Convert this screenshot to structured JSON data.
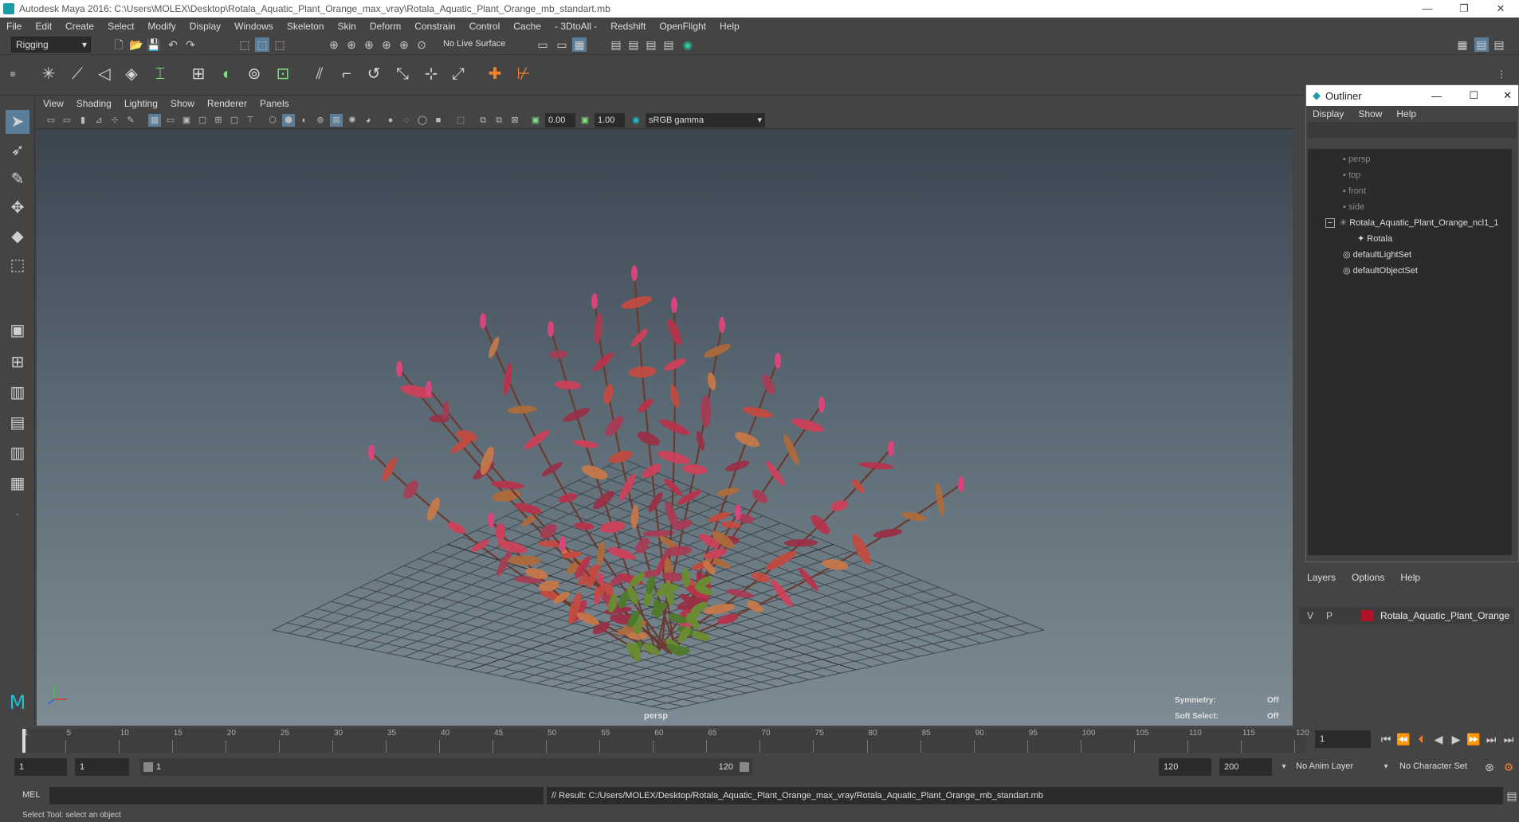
{
  "window": {
    "title": "Autodesk Maya 2016: C:\\Users\\MOLEX\\Desktop\\Rotala_Aquatic_Plant_Orange_max_vray\\Rotala_Aquatic_Plant_Orange_mb_standart.mb",
    "minimize": "—",
    "restore": "❐",
    "close": "✕"
  },
  "menubar": [
    "File",
    "Edit",
    "Create",
    "Select",
    "Modify",
    "Display",
    "Windows",
    "Skeleton",
    "Skin",
    "Deform",
    "Constrain",
    "Control",
    "Cache",
    "- 3DtoAll -",
    "Redshift",
    "OpenFlight",
    "Help"
  ],
  "statusline": {
    "mode": "Rigging",
    "live_surface": "No Live Surface"
  },
  "panel_menu": [
    "View",
    "Shading",
    "Lighting",
    "Show",
    "Renderer",
    "Panels"
  ],
  "viewport_toolbar": {
    "exposure": "0.00",
    "gamma": "1.00",
    "color_space": "sRGB gamma"
  },
  "viewport": {
    "camera_label": "persp",
    "hud": {
      "symmetry_label": "Symmetry:",
      "symmetry_value": "Off",
      "soft_select_label": "Soft Select:",
      "soft_select_value": "Off"
    }
  },
  "outliner": {
    "title": "Outliner",
    "menu": [
      "Display",
      "Show",
      "Help"
    ],
    "items": [
      {
        "label": "persp",
        "dim": true
      },
      {
        "label": "top",
        "dim": true
      },
      {
        "label": "front",
        "dim": true
      },
      {
        "label": "side",
        "dim": true
      },
      {
        "label": "Rotala_Aquatic_Plant_Orange_ncl1_1",
        "dim": false
      },
      {
        "label": "Rotala",
        "dim": false
      },
      {
        "label": "defaultLightSet",
        "dim": false
      },
      {
        "label": "defaultObjectSet",
        "dim": false
      }
    ],
    "collapse_symbol": "−"
  },
  "layers": {
    "menu": [
      "Layers",
      "Options",
      "Help"
    ],
    "row": {
      "visible": "V",
      "playback": "P",
      "name": "Rotala_Aquatic_Plant_Orange",
      "color": "#b0142a"
    }
  },
  "timeline": {
    "ticks": [
      "1",
      "5",
      "10",
      "15",
      "20",
      "25",
      "30",
      "35",
      "40",
      "45",
      "50",
      "55",
      "60",
      "65",
      "70",
      "75",
      "80",
      "85",
      "90",
      "95",
      "100",
      "105",
      "110",
      "115",
      "120"
    ],
    "current_frame": "1"
  },
  "range": {
    "start": "1",
    "playback_start": "1",
    "slider_start": "1",
    "slider_end": "120",
    "playback_end": "120",
    "end": "200",
    "anim_layer": "No Anim Layer",
    "character_set": "No Character Set"
  },
  "commandline": {
    "lang": "MEL",
    "result": "// Result: C:/Users/MOLEX/Desktop/Rotala_Aquatic_Plant_Orange_max_vray/Rotala_Aquatic_Plant_Orange_mb_standart.mb"
  },
  "helpline": "Select Tool: select an object",
  "colors": {
    "bg": "#444444",
    "field": "#2b2b2b",
    "accent": "#1a9ba5",
    "layer": "#b0142a"
  }
}
